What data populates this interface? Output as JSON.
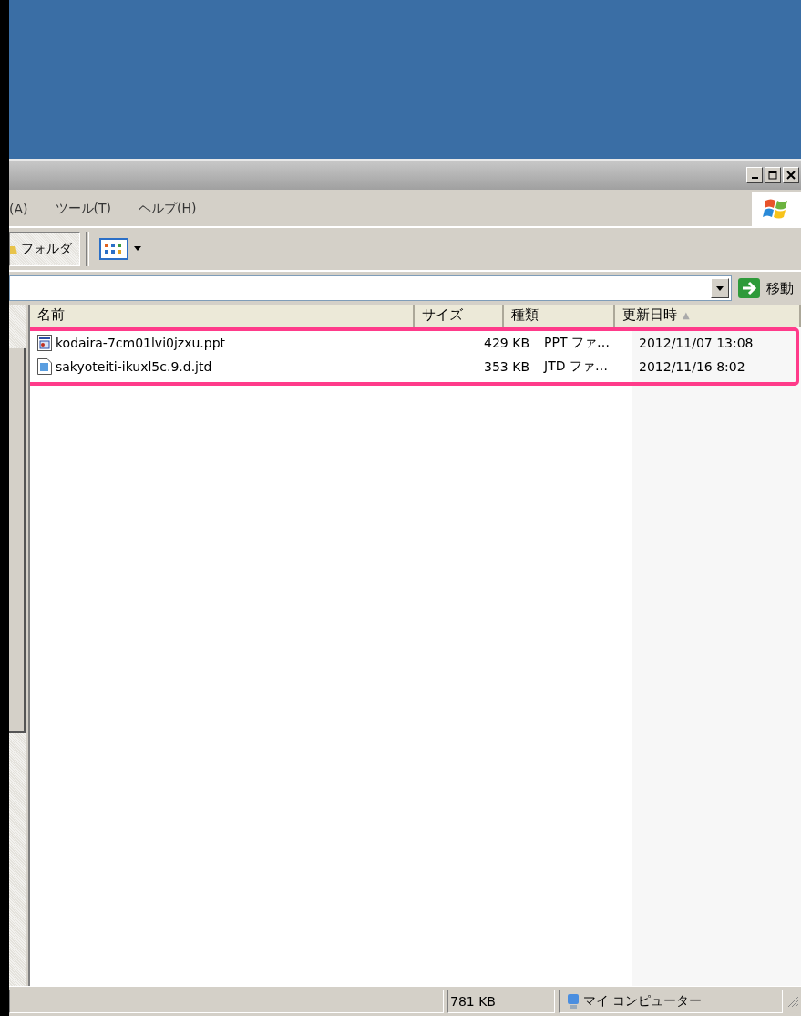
{
  "menu": [
    "(A)",
    "ツール(T)",
    "ヘルプ(H)"
  ],
  "toolbar": {
    "folders_button": {
      "label": "フォルダ",
      "selected": true
    }
  },
  "address": {
    "go_label": "移動"
  },
  "columns": [
    {
      "label": "名前"
    },
    {
      "label": "サイズ"
    },
    {
      "label": "種類"
    },
    {
      "label": "更新日時",
      "sort": "▲"
    }
  ],
  "rows": [
    {
      "kind": "presentation",
      "name": "kodaira-7cm01lvi0jzxu.ppt",
      "size": "429 KB",
      "type": "PPT ファ…",
      "modified": "2012/11/07 13:08"
    },
    {
      "kind": "document",
      "name": "sakyoteiti-ikuxl5c.9.d.jtd",
      "size": "353 KB",
      "type": "JTD ファ…",
      "modified": "2012/11/16 8:02"
    }
  ],
  "status_bar": {
    "size": "781 KB",
    "zone": "マイ コンピューター"
  }
}
